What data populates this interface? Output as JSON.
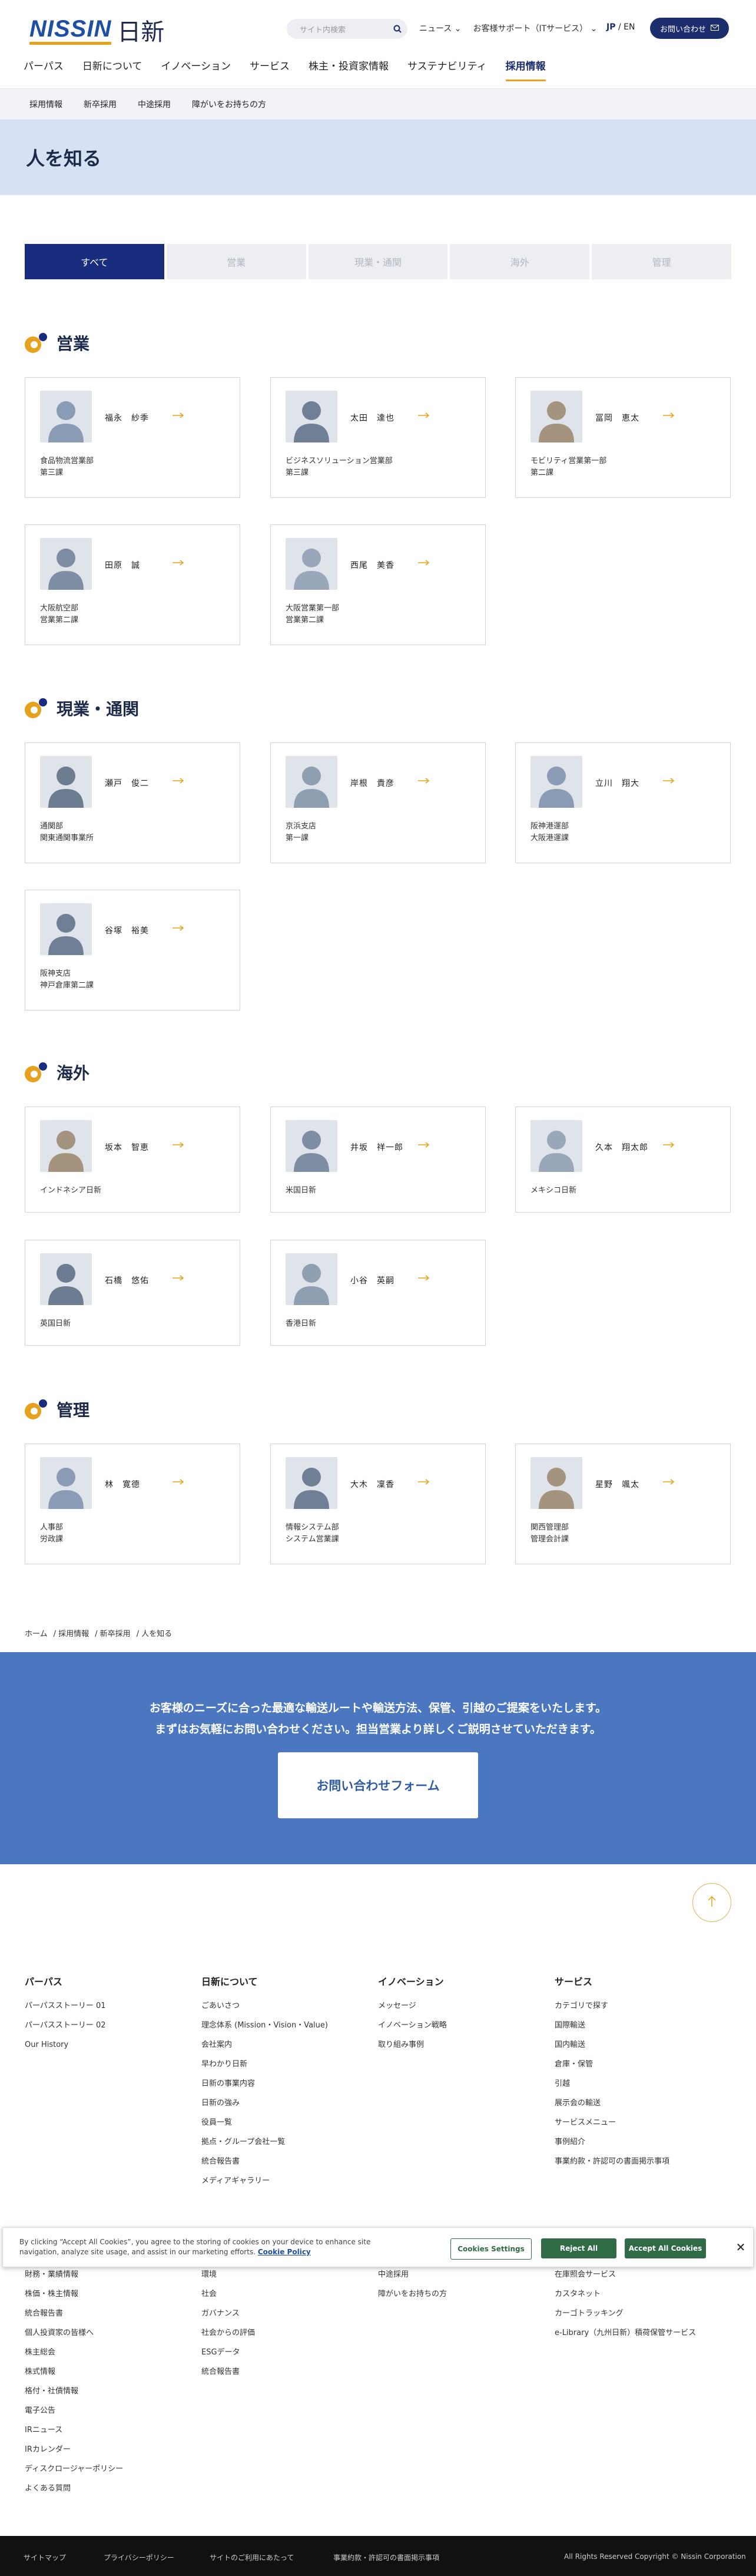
{
  "header": {
    "logo_text": "NISSIN",
    "logo_kanji": "日新",
    "search_placeholder": "サイト内検索",
    "top_nav": [
      "ニュース",
      "お客様サポート（ITサービス）"
    ],
    "lang_jp": "JP",
    "lang_sep": "/",
    "lang_en": "EN",
    "contact_label": "お問い合わせ",
    "main_nav": [
      "パーパス",
      "日新について",
      "イノベーション",
      "サービス",
      "株主・投資家情報",
      "サステナビリティ",
      "採用情報"
    ],
    "main_nav_active": "採用情報"
  },
  "subnav": [
    "採用情報",
    "新卒採用",
    "中途採用",
    "障がいをお持ちの方"
  ],
  "page_title": "人を知る",
  "tabs": [
    "すべて",
    "営業",
    "現業・通関",
    "海外",
    "管理"
  ],
  "sections": [
    {
      "title": "営業",
      "people": [
        {
          "name": "福永　紗季",
          "dept": [
            "食品物流営業部",
            "第三課"
          ]
        },
        {
          "name": "太田　達也",
          "dept": [
            "ビジネスソリューション営業部",
            "第三課"
          ]
        },
        {
          "name": "冨岡　恵太",
          "dept": [
            "モビリティ営業第一部",
            "第二課"
          ]
        },
        {
          "name": "田原　誠",
          "dept": [
            "大阪航空部",
            "営業第二課"
          ]
        },
        {
          "name": "西尾　美香",
          "dept": [
            "大阪営業第一部",
            "営業第二課"
          ]
        }
      ]
    },
    {
      "title": "現業・通関",
      "people": [
        {
          "name": "瀬戸　俊二",
          "dept": [
            "通関部",
            "関東通関事業所"
          ]
        },
        {
          "name": "岸根　貴彦",
          "dept": [
            "京浜支店",
            "第一課"
          ]
        },
        {
          "name": "立川　翔大",
          "dept": [
            "阪神港運部",
            "大阪港運課"
          ]
        },
        {
          "name": "谷塚　裕美",
          "dept": [
            "阪神支店",
            "神戸倉庫第二課"
          ]
        }
      ]
    },
    {
      "title": "海外",
      "people": [
        {
          "name": "坂本　智恵",
          "dept": [
            "インドネシア日新"
          ]
        },
        {
          "name": "井坂　祥一郎",
          "dept": [
            "米国日新"
          ]
        },
        {
          "name": "久本　翔太郎",
          "dept": [
            "メキシコ日新"
          ]
        },
        {
          "name": "石橋　悠佑",
          "dept": [
            "英国日新"
          ]
        },
        {
          "name": "小谷　英嗣",
          "dept": [
            "香港日新"
          ]
        }
      ]
    },
    {
      "title": "管理",
      "people": [
        {
          "name": "林　寛德",
          "dept": [
            "人事部",
            "労政課"
          ]
        },
        {
          "name": "大木　凜香",
          "dept": [
            "情報システム部",
            "システム営業課"
          ]
        },
        {
          "name": "星野　颯太",
          "dept": [
            "関西管理部",
            "管理会計課"
          ]
        }
      ]
    }
  ],
  "breadcrumb": [
    "ホーム",
    "/ 採用情報",
    "/ 新卒採用",
    "/ 人を知る"
  ],
  "cta": {
    "line1": "お客様のニーズに合った最適な輸送ルートや輸送方法、保管、引越のご提案をいたします。",
    "line2": "まずはお気軽にお問い合わせください。担当営業より詳しくご説明させていただきます。",
    "button": "お問い合わせフォーム"
  },
  "footer_cols": [
    {
      "head": "パーパス",
      "items": [
        "パーパスストーリー 01",
        "パーパスストーリー 02",
        "Our History"
      ]
    },
    {
      "head": "日新について",
      "items": [
        "ごあいさつ",
        "理念体系 (Mission・Vision・Value)",
        "会社案内",
        "早わかり日新",
        "日新の事業内容",
        "日新の強み",
        "役員一覧",
        "拠点・グループ会社一覧",
        "統合報告書",
        "メディアギャラリー"
      ]
    },
    {
      "head": "イノベーション",
      "items": [
        "メッセージ",
        "イノベーション戦略",
        "取り組み事例"
      ]
    },
    {
      "head": "サービス",
      "items": [
        "カテゴリで探す",
        "国際輸送",
        "国内輸送",
        "倉庫・保管",
        "引越",
        "展示会の輸送",
        "サービスメニュー",
        "事例紹介",
        "事業約款・許認可の書面掲示事項"
      ]
    }
  ],
  "footer_lower_cols": [
    {
      "items": [
        "財務・業績情報",
        "株価・株主情報",
        "統合報告書",
        "個人投資家の皆様へ",
        "株主総会",
        "株式情報",
        "格付・社債情報",
        "電子公告",
        "IRニュース",
        "IRカレンダー",
        "ディスクロージャーポリシー",
        "よくある質問"
      ]
    },
    {
      "items": [
        "環境",
        "社会",
        "ガバナンス",
        "社会からの評価",
        "ESGデータ",
        "統合報告書"
      ]
    },
    {
      "items": [
        "中途採用",
        "障がいをお持ちの方"
      ]
    },
    {
      "items": [
        "在庫照会サービス",
        "カスタネット",
        "カーゴトラッキング",
        "e-Library（九州日新）積荷保管サービス"
      ]
    }
  ],
  "cookie": {
    "text": "By clicking “Accept All Cookies”, you agree to the storing of cookies on your device to enhance site navigation, analyze site usage, and assist in our marketing efforts.",
    "policy": "Cookie Policy",
    "settings": "Cookies Settings",
    "reject": "Reject All",
    "accept": "Accept All Cookies"
  },
  "bottom_links": [
    "サイトマップ",
    "プライバシーポリシー",
    "サイトのご利用にあたって",
    "事業約款・許認可の書面掲示事項"
  ],
  "copyright": "All Rights Reserved Copyright © Nissin Corporation",
  "colors": {
    "navy": "#1a2c7e",
    "accent": "#e6a21c",
    "cta_blue": "#4a77bf",
    "hero_bg": "#d6e2f4"
  }
}
